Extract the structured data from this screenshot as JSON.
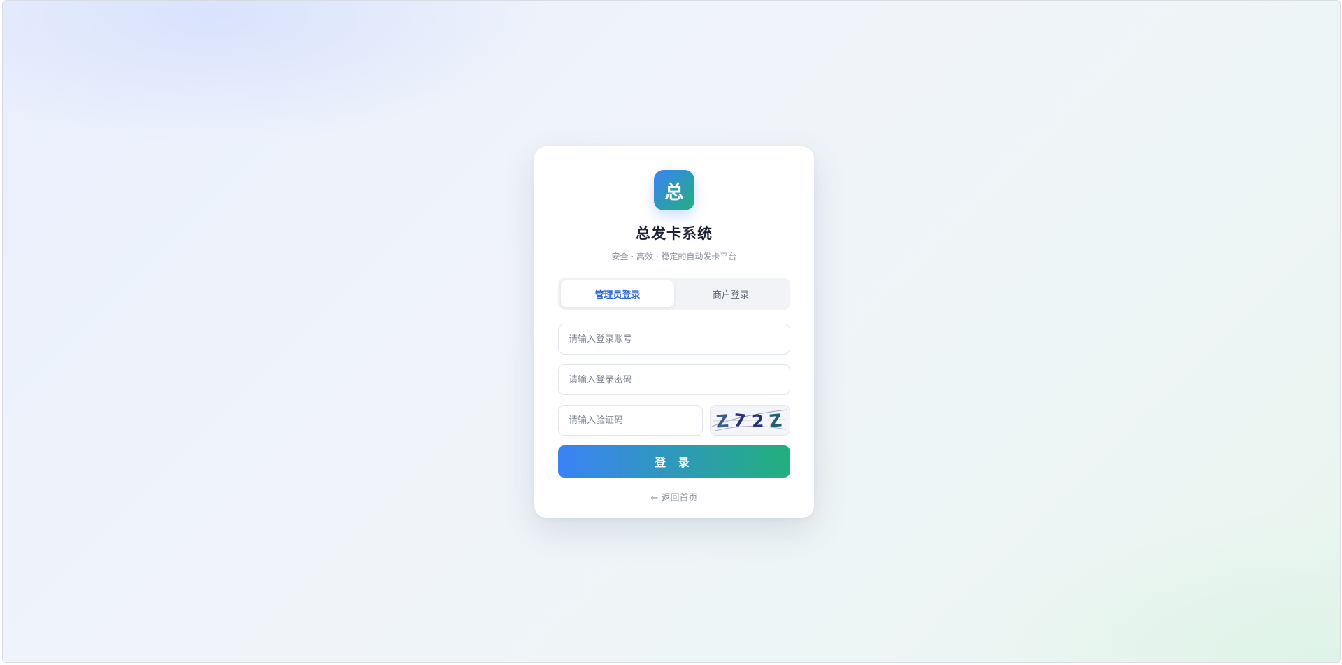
{
  "app": {
    "logo_char": "总",
    "title": "总发卡系统",
    "subtitle": "安全 · 高效 · 稳定的自动发卡平台"
  },
  "tabs": [
    {
      "label": "管理员登录",
      "active": true
    },
    {
      "label": "商户登录",
      "active": false
    }
  ],
  "form": {
    "account_placeholder": "请输入登录账号",
    "password_placeholder": "请输入登录密码",
    "captcha_placeholder": "请输入验证码",
    "captcha_text": [
      "Z",
      "7",
      "2",
      "Z"
    ],
    "login_label": "登 录",
    "back_label": "← 返回首页"
  },
  "colors": {
    "accent_blue": "#3b82f6",
    "accent_green": "#22b07d",
    "tab_active_text": "#2f66d1"
  }
}
